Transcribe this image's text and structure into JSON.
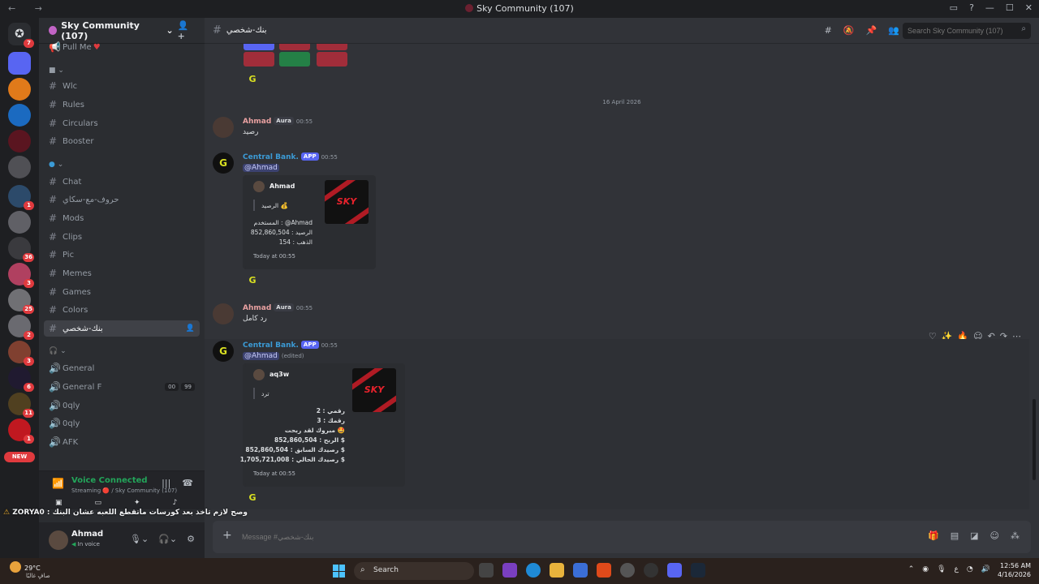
{
  "window": {
    "title": "Sky Community (107)"
  },
  "guild": {
    "name": "Sky Community (107)"
  },
  "server_badges": {
    "s0": "7",
    "s8": "1",
    "s10": "36",
    "s11": "3",
    "s12": "25",
    "s13": "2",
    "s14": "3",
    "s15": "6",
    "s16": "11",
    "s17": "1",
    "new": "NEW"
  },
  "channels": {
    "pull_me": "Pull Me",
    "cat1": "⌄",
    "wlc": "Wlc",
    "rules": "Rules",
    "circulars": "Circulars",
    "booster": "Booster",
    "cat2": "⌄",
    "chat": "Chat",
    "huroof": "حروف-مع-سكاي",
    "mods": "Mods",
    "clips": "Clips",
    "pic": "Pic",
    "memes": "Memes",
    "games": "Games",
    "colors": "Colors",
    "bank": "بنك-شخصي",
    "cat3": "⌄",
    "general": "General",
    "general_f": "General F",
    "general_f_counts": [
      "00",
      "99"
    ],
    "oqly1": "0qly",
    "oqly2": "0qly",
    "afk": "AFK"
  },
  "voice": {
    "status": "Voice Connected",
    "detail": "Streaming 🔴 / Sky Community (107)"
  },
  "user": {
    "name": "Ahmad",
    "status": "In voice"
  },
  "header": {
    "channel": "بنك-شخصي",
    "search_placeholder": "Search Sky Community (107)"
  },
  "date_divider": "16 April 2026",
  "messages": [
    {
      "author": "Ahmad",
      "tag": "Aura",
      "time": "00:55",
      "text": "رصيد"
    },
    {
      "author": "Central Bank.",
      "tag": "APP",
      "time": "00:55",
      "mention": "@Ahmad",
      "embed": {
        "author": "Ahmad",
        "title": "الرصيد 💰",
        "lines": [
          "المستخدم : @Ahmad",
          "الرصيد : 852,860,504",
          "الذهب : 154"
        ],
        "footer": "Today at 00:55",
        "thumb": "SKY"
      }
    },
    {
      "author": "Ahmad",
      "tag": "Aura",
      "time": "00:55",
      "text": "رد كامل"
    },
    {
      "author": "Central Bank.",
      "tag": "APP",
      "time": "00:55",
      "mention": "@Ahmad",
      "edited": "(edited)",
      "embed": {
        "author": "aq3w",
        "title": "ترد",
        "lines": [
          "رقمي : 2",
          "رقمك : 3",
          "مبروك لقد ربحت 🤩",
          "الربح : 852,860,504 $",
          "رصيدك السابق : 852,860,504 $",
          "رصيدك الحالي : 1,705,721,008 $"
        ],
        "footer": "Today at 00:55",
        "thumb": "SKY"
      }
    }
  ],
  "notice": "ZORYA0 : وصح لازم تاخذ بعد كورسات ماتقطع اللعبه عشان البنك",
  "composer": {
    "placeholder": "Message #بنك-شخصي"
  },
  "taskbar": {
    "temp": "29°C",
    "weather": "صافٍ غالبًا",
    "search": "Search",
    "time": "12:56 AM",
    "date": "4/16/2026",
    "lang": "ع"
  },
  "colors": {
    "accent": "#5865f2",
    "online": "#23a55a",
    "bank_name": "#3b9bd6",
    "ahmad_name": "#e8a0a0"
  }
}
